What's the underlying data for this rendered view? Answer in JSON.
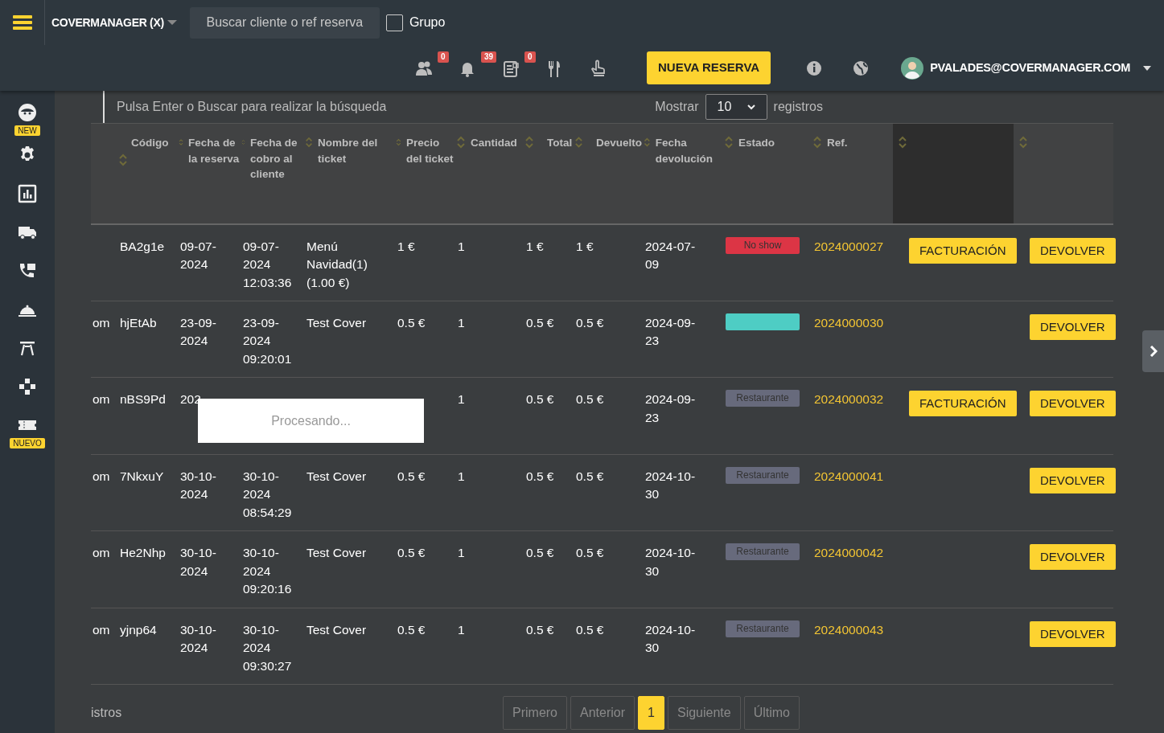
{
  "topbar": {
    "brand": "COVERMANAGER (X)",
    "search": {
      "placeholder": "Buscar cliente o ref reserva"
    },
    "group": {
      "label": "Grupo",
      "checked": false
    },
    "indicators": [
      {
        "kind": "users",
        "count": "0"
      },
      {
        "kind": "bell",
        "count": "39"
      },
      {
        "kind": "clipboard",
        "count": "0"
      },
      {
        "kind": "utensils"
      },
      {
        "kind": "hand"
      }
    ],
    "new_button": "NUEVA RESERVA",
    "user": "PVALADES@COVERMANAGER.COM"
  },
  "sidebar": {
    "items": [
      {
        "kind": "face",
        "badge": "NEW"
      },
      {
        "kind": "gear"
      },
      {
        "kind": "chart"
      },
      {
        "kind": "truck"
      },
      {
        "kind": "phone"
      },
      {
        "kind": "cloche"
      },
      {
        "kind": "table"
      },
      {
        "kind": "puzzle"
      },
      {
        "kind": "ticket",
        "badge": "NUEVO"
      }
    ]
  },
  "toolbar": {
    "hint": "Pulsa Enter o Buscar para realizar la búsqueda",
    "show_label": "Mostrar",
    "page_size": "10",
    "records_label": "registros"
  },
  "table": {
    "columns": [
      "Código",
      "Fecha de la reserva",
      "Fecha de cobro al cliente",
      "Nombre del ticket",
      "Precio del ticket",
      "Cantidad",
      "Total",
      "Devuelto",
      "Fecha devolución",
      "Estado",
      "Ref."
    ],
    "rows": [
      {
        "code": "BA2g1e",
        "booking_date": "09-07-2024",
        "charge_date": "09-07-2024 12:03:36",
        "ticket_name": "Menú Navidad(1) (1.00 €)",
        "price": "1 €",
        "quantity": "1",
        "total": "1 €",
        "returned": "1 €",
        "return_date": "2024-07-09",
        "status": {
          "label": "No show",
          "color": "#dc3545"
        },
        "ref": "2024000027",
        "invoice_button": "FACTURACIÓN",
        "return_button": "DEVOLVER"
      },
      {
        "column_1": "om",
        "code": "hjEtAb",
        "booking_date": "23-09-2024",
        "charge_date": "23-09-2024 09:20:01",
        "ticket_name": "Test Cover",
        "price": "0.5 €",
        "quantity": "1",
        "total": "0.5 €",
        "returned": "0.5 €",
        "return_date": "2024-09-23",
        "status": {
          "color": "#4ecdc4"
        },
        "ref": "2024000030",
        "return_button": "DEVOLVER"
      },
      {
        "column_1": "om",
        "code": "nBS9Pd",
        "booking_date": "202",
        "quantity": "1",
        "total": "0.5 €",
        "returned": "0.5 €",
        "return_date": "2024-09-23",
        "status": {
          "label": "Restaurante",
          "color": "#676a7c"
        },
        "ref": "2024000032",
        "invoice_button": "FACTURACIÓN",
        "return_button": "DEVOLVER"
      },
      {
        "column_1": "om",
        "code": "7NkxuY",
        "booking_date": "30-10-2024",
        "charge_date": "30-10-2024 08:54:29",
        "ticket_name": "Test Cover",
        "price": "0.5 €",
        "quantity": "1",
        "total": "0.5 €",
        "returned": "0.5 €",
        "return_date": "2024-10-30",
        "status": {
          "label": "Restaurante",
          "color": "#676a7c"
        },
        "ref": "2024000041",
        "return_button": "DEVOLVER"
      },
      {
        "column_1": "om",
        "code": "He2Nhp",
        "booking_date": "30-10-2024",
        "charge_date": "30-10-2024 09:20:16",
        "ticket_name": "Test Cover",
        "price": "0.5 €",
        "quantity": "1",
        "total": "0.5 €",
        "returned": "0.5 €",
        "return_date": "2024-10-30",
        "status": {
          "label": "Restaurante",
          "color": "#676a7c"
        },
        "ref": "2024000042",
        "return_button": "DEVOLVER"
      },
      {
        "column_1": "om",
        "code": "yjnp64",
        "booking_date": "30-10-2024",
        "charge_date": "30-10-2024 09:30:27",
        "ticket_name": "Test Cover",
        "price": "0.5 €",
        "quantity": "1",
        "total": "0.5 €",
        "returned": "0.5 €",
        "return_date": "2024-10-30",
        "status": {
          "label": "Restaurante",
          "color": "#676a7c"
        },
        "ref": "2024000043",
        "return_button": "DEVOLVER"
      }
    ],
    "processing": "Procesando..."
  },
  "footer": {
    "info": "istros",
    "pagination": [
      {
        "label": "Primero",
        "selected": false
      },
      {
        "label": "Anterior",
        "selected": false
      },
      {
        "label": "1",
        "selected": true
      },
      {
        "label": "Siguiente",
        "selected": false
      },
      {
        "label": "Último",
        "selected": false
      }
    ]
  }
}
